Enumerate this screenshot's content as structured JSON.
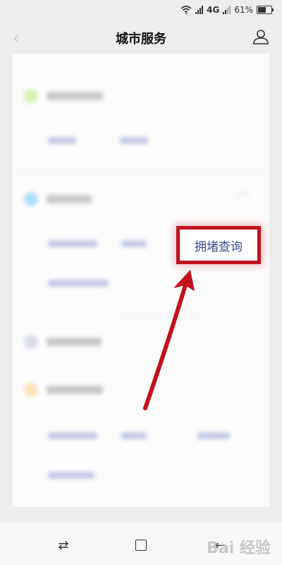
{
  "status": {
    "network": "4G",
    "battery_percent": "61%",
    "battery_level": 0.61
  },
  "header": {
    "title": "城市服务",
    "back_icon": "chevron-left-icon",
    "user_icon": "user-icon"
  },
  "highlight": {
    "label": "拥堵查询",
    "frame_color": "#c1111b"
  },
  "annotation": {
    "arrow_color": "#c1111b"
  },
  "watermark": {
    "text": "Bai 经验"
  },
  "navbar": {
    "left_icon": "switch-icon",
    "center_icon": "recent-apps-icon",
    "right_icon": "back-icon"
  }
}
